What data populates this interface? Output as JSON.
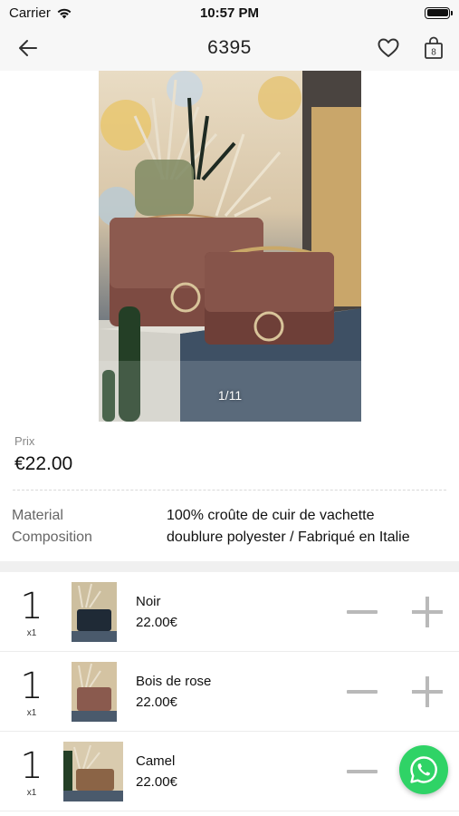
{
  "status_bar": {
    "carrier": "Carrier",
    "time": "10:57 PM"
  },
  "nav": {
    "title": "6395",
    "cart_count": "8"
  },
  "gallery": {
    "counter": "1/11"
  },
  "price": {
    "label": "Prix",
    "value": "€22.00"
  },
  "specs": {
    "labels": [
      "Material",
      "Composition"
    ],
    "values": [
      "100% croûte de cuir de vachette",
      "doublure polyester / Fabriqué en Italie"
    ]
  },
  "variants": [
    {
      "qty": "1",
      "qty_unit": "x1",
      "name": "Noir",
      "price": "22.00€",
      "color": "#1f2a36"
    },
    {
      "qty": "1",
      "qty_unit": "x1",
      "name": "Bois de rose",
      "price": "22.00€",
      "color": "#8a5a4e"
    },
    {
      "qty": "1",
      "qty_unit": "x1",
      "name": "Camel",
      "price": "22.00€",
      "color": "#8b6446"
    }
  ],
  "colors": {
    "accent_whatsapp": "#2fd366",
    "control_gray": "#b9b9b9",
    "bag_brown": "#7d4b42"
  }
}
